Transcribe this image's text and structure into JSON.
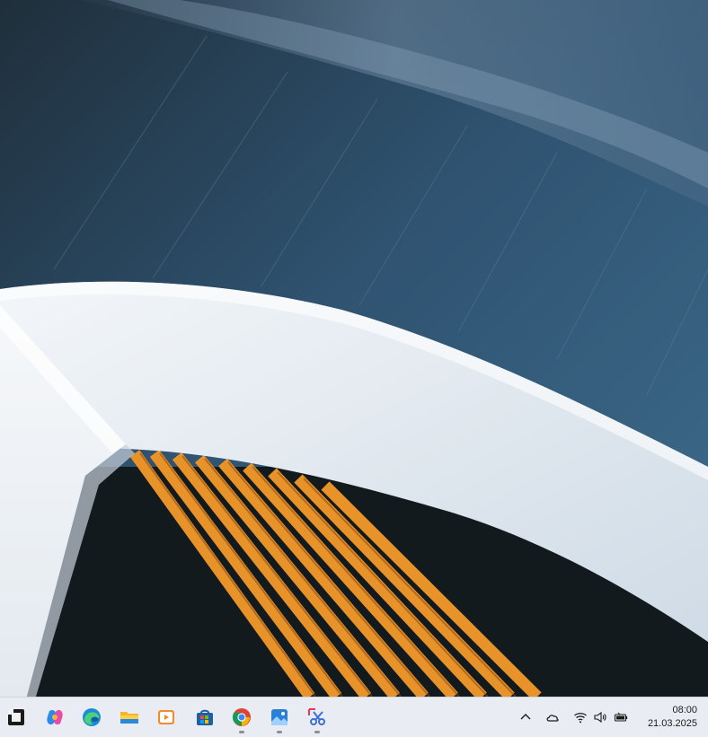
{
  "taskbar": {
    "apps": [
      {
        "name": "start",
        "icon": "windows-start-icon"
      },
      {
        "name": "copilot",
        "icon": "copilot-icon"
      },
      {
        "name": "edge",
        "icon": "edge-browser-icon"
      },
      {
        "name": "file-explorer",
        "icon": "folder-icon"
      },
      {
        "name": "media-player",
        "icon": "media-player-icon"
      },
      {
        "name": "microsoft-store",
        "icon": "store-bag-icon"
      },
      {
        "name": "chrome",
        "icon": "chrome-icon",
        "running": true
      },
      {
        "name": "photos",
        "icon": "photos-icon",
        "running": true
      },
      {
        "name": "snipping-tool",
        "icon": "scissors-icon",
        "running": true
      }
    ],
    "tray": {
      "icons": [
        "chevron-up-icon",
        "onedrive-cloud-icon",
        "wifi-icon",
        "speaker-icon",
        "battery-icon"
      ]
    },
    "clock": {
      "time": "08:00",
      "date": "21.03.2025"
    }
  },
  "colors": {
    "taskbar_bg": "#e9edf3",
    "accent_orange": "#e8922a",
    "wall_blue": "#3b6685"
  }
}
